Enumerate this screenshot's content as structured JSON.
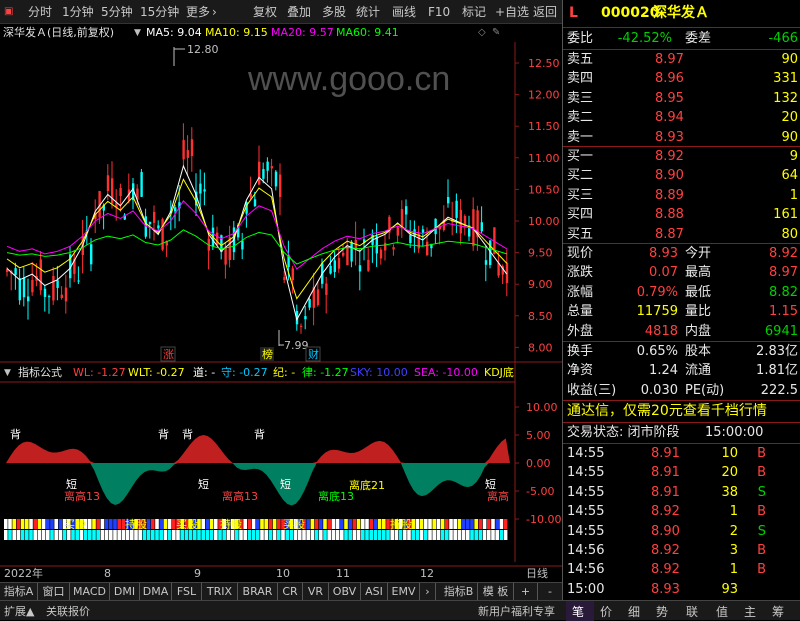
{
  "toolbar": {
    "nav": [
      "分时",
      "1分钟",
      "5分钟",
      "15分钟",
      "更多"
    ],
    "more_arrow": "›",
    "tools": [
      "复权",
      "叠加",
      "多股",
      "统计",
      "画线",
      "F10",
      "标记",
      "+自选",
      "返回"
    ]
  },
  "chart": {
    "title": "深华发Ａ(日线,前复权)",
    "ma5": "MA5: 9.04",
    "ma10": "MA10: 9.15",
    "ma20": "MA20: 9.57",
    "ma60": "MA60: 9.41",
    "watermark": "www.gooo.cn",
    "high_label": "12.80",
    "low_label": "7.99",
    "y_ticks": [
      "12.50",
      "12.00",
      "11.50",
      "11.00",
      "10.50",
      "10.00",
      "9.50",
      "9.00",
      "8.50",
      "8.00"
    ],
    "markers": [
      "涨",
      "榜",
      "财"
    ],
    "colors": {
      "ma5": "#ffffff",
      "ma10": "#ffff00",
      "ma20": "#ff00ff",
      "ma60": "#00ff00",
      "up": "#ff3030",
      "down": "#00ffff"
    }
  },
  "indicator": {
    "name": "指标公式",
    "wl": "WL: -1.27",
    "wlt": "WLT: -0.27",
    "dao": "道: -",
    "shou": "守: -0.27",
    "ji": "纪: -",
    "lv": "律: -1.27",
    "sky": "SKY: 10.00",
    "sea": "SEA: -10.00",
    "kdj": "KDJ底",
    "y_ticks": [
      "10.00",
      "5.00",
      "0.00",
      "-5.00",
      "-10.00"
    ],
    "labels": [
      "背",
      "背",
      "背",
      "背",
      "短",
      "短",
      "短",
      "短",
      "离高13",
      "离高13",
      "离底13",
      "离底21",
      "离高",
      "买股",
      "持股",
      "买股",
      "持股",
      "买股",
      "持股"
    ]
  },
  "axis": {
    "year": "2022年",
    "months": [
      "8",
      "9",
      "10",
      "11",
      "12"
    ],
    "period": "日线"
  },
  "tabs": [
    "指标A",
    "窗口",
    "MACD",
    "DMI",
    "DMA",
    "FSL",
    "TRIX",
    "BRAR",
    "CR",
    "VR",
    "OBV",
    "ASI",
    "EMV",
    "›",
    "指标B",
    "模 板",
    "+",
    "-"
  ],
  "bottom": {
    "left": [
      "扩展▲",
      "关联报价"
    ],
    "promo": "新用户福利专享",
    "icons": [
      "笔",
      "价",
      "细",
      "势",
      "联",
      "值",
      "主",
      "筹"
    ]
  },
  "quote": {
    "flag": "L",
    "code": "000020",
    "name": "深华发Ａ",
    "weibi_label": "委比",
    "weibi": "-42.52%",
    "weicha_label": "委差",
    "weicha": "-466",
    "sells": [
      {
        "label": "卖五",
        "price": "8.97",
        "vol": "90"
      },
      {
        "label": "卖四",
        "price": "8.96",
        "vol": "331"
      },
      {
        "label": "卖三",
        "price": "8.95",
        "vol": "132"
      },
      {
        "label": "卖二",
        "price": "8.94",
        "vol": "20"
      },
      {
        "label": "卖一",
        "price": "8.93",
        "vol": "90"
      }
    ],
    "buys": [
      {
        "label": "买一",
        "price": "8.92",
        "vol": "9"
      },
      {
        "label": "买二",
        "price": "8.90",
        "vol": "64"
      },
      {
        "label": "买三",
        "price": "8.89",
        "vol": "1"
      },
      {
        "label": "买四",
        "price": "8.88",
        "vol": "161"
      },
      {
        "label": "买五",
        "price": "8.87",
        "vol": "80"
      }
    ],
    "stats": [
      {
        "l1": "现价",
        "v1": "8.93",
        "c1": "red",
        "l2": "今开",
        "v2": "8.92",
        "c2": "red"
      },
      {
        "l1": "涨跌",
        "v1": "0.07",
        "c1": "red",
        "l2": "最高",
        "v2": "8.97",
        "c2": "red"
      },
      {
        "l1": "涨幅",
        "v1": "0.79%",
        "c1": "red",
        "l2": "最低",
        "v2": "8.82",
        "c2": "green"
      },
      {
        "l1": "总量",
        "v1": "11759",
        "c1": "yellow",
        "l2": "量比",
        "v2": "1.15",
        "c2": "red"
      },
      {
        "l1": "外盘",
        "v1": "4818",
        "c1": "red",
        "l2": "内盘",
        "v2": "6941",
        "c2": "green"
      }
    ],
    "stats2": [
      {
        "l1": "换手",
        "v1": "0.65%",
        "l2": "股本",
        "v2": "2.83亿"
      },
      {
        "l1": "净资",
        "v1": "1.24",
        "l2": "流通",
        "v2": "1.81亿"
      },
      {
        "l1": "收益(三)",
        "v1": "0.030",
        "l2": "PE(动)",
        "v2": "222.5"
      }
    ],
    "ad": "通达信，仅需20元查看千档行情",
    "status": "交易状态: 闭市阶段",
    "status_time": "15:00:00",
    "trades": [
      {
        "t": "14:55",
        "p": "8.91",
        "v": "10",
        "s": "B",
        "pc": "red"
      },
      {
        "t": "14:55",
        "p": "8.91",
        "v": "20",
        "s": "B",
        "pc": "red"
      },
      {
        "t": "14:55",
        "p": "8.91",
        "v": "38",
        "s": "S",
        "pc": "red"
      },
      {
        "t": "14:55",
        "p": "8.92",
        "v": "1",
        "s": "B",
        "pc": "red"
      },
      {
        "t": "14:55",
        "p": "8.90",
        "v": "2",
        "s": "S",
        "pc": "red"
      },
      {
        "t": "14:56",
        "p": "8.92",
        "v": "3",
        "s": "B",
        "pc": "red"
      },
      {
        "t": "14:56",
        "p": "8.92",
        "v": "1",
        "s": "B",
        "pc": "red"
      },
      {
        "t": "15:00",
        "p": "8.93",
        "v": "93",
        "s": "",
        "pc": "red"
      }
    ]
  }
}
